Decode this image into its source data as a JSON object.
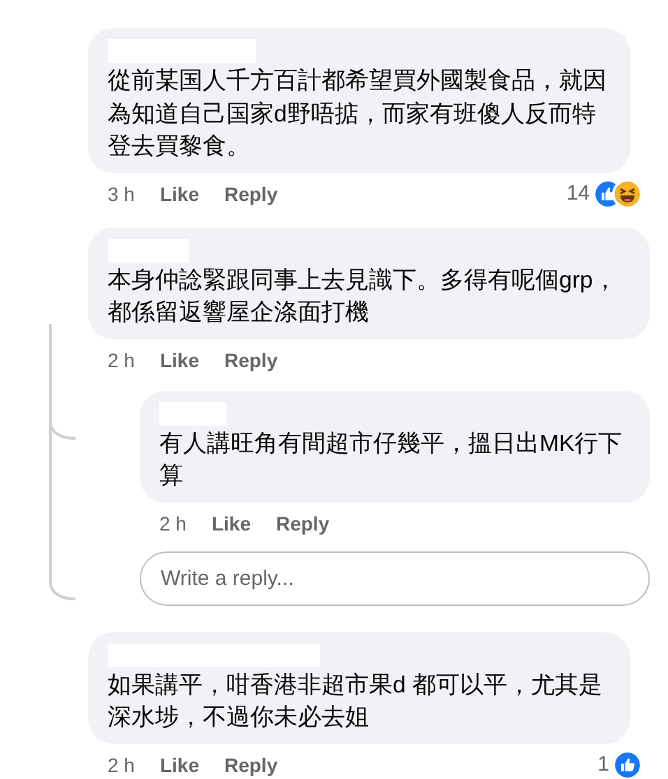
{
  "comments": [
    {
      "text": "從前某国人千方百計都希望買外國製食品，就因為知道自己国家d野唔掂，而家有班傻人反而特登去買黎食。",
      "time": "3 h",
      "like": "Like",
      "reply": "Reply",
      "reaction_count": "14",
      "reactions": [
        {
          "kind": "like"
        },
        {
          "kind": "haha"
        }
      ]
    },
    {
      "text": "本身仲諗緊跟同事上去見識下。多得有呢個grp，都係留返響屋企涤面打機",
      "time": "2 h",
      "like": "Like",
      "reply": "Reply",
      "replies": [
        {
          "text": "有人講旺角有間超市仔幾平，搵日出MK行下算",
          "time": "2 h",
          "like": "Like",
          "reply": "Reply"
        }
      ],
      "reply_field": {
        "placeholder": "Write a reply..."
      }
    },
    {
      "text": "如果講平，咁香港非超市果d 都可以平，尤其是深水埗，不過你未必去姐",
      "time": "2 h",
      "like": "Like",
      "reply": "Reply",
      "reaction_count": "1",
      "reactions": [
        {
          "kind": "like"
        }
      ]
    }
  ]
}
